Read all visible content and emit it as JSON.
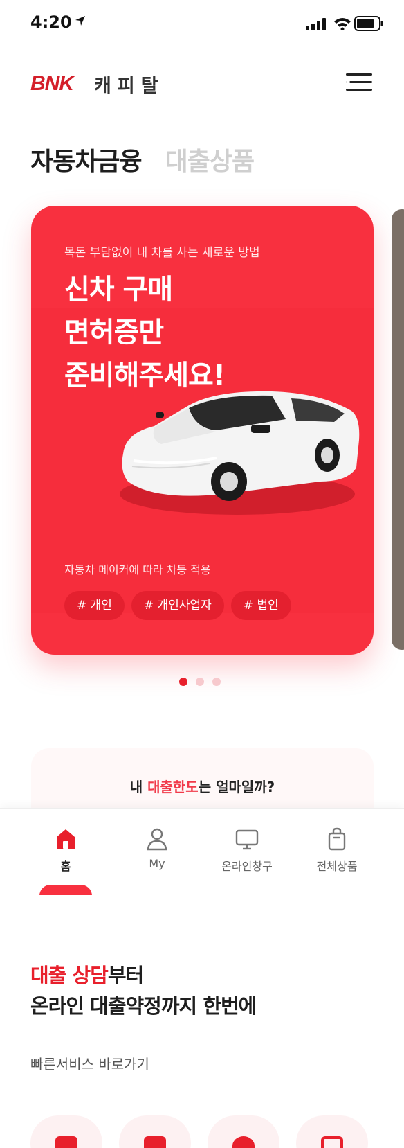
{
  "status_bar": {
    "time": "4:20"
  },
  "header": {
    "logo_brand": "BNK",
    "logo_sub": "캐피탈"
  },
  "tabs": [
    {
      "label": "자동차금융",
      "active": true
    },
    {
      "label": "대출상품",
      "active": false
    }
  ],
  "hero_card": {
    "eyebrow": "목돈 부담없이 내 차를 사는 새로운 방법",
    "title_lines": [
      "신차 구매",
      "면허증만",
      "준비해주세요!"
    ],
    "note": "자동차 메이커에 따라 차등 적용",
    "tags": [
      "# 개인",
      "# 개인사업자",
      "# 법인"
    ],
    "background_color": "#f8303f"
  },
  "carousel": {
    "total": 3,
    "current": 1
  },
  "limit_card": {
    "prefix": "내 ",
    "highlight": "대출한도",
    "suffix": "는 얼마일까?"
  },
  "tabbar": {
    "items": [
      {
        "label": "홈",
        "icon": "home-icon",
        "active": true
      },
      {
        "label": "My",
        "icon": "person-icon",
        "active": false
      },
      {
        "label": "온라인창구",
        "icon": "monitor-icon",
        "active": false
      },
      {
        "label": "전체상품",
        "icon": "bag-icon",
        "active": false
      }
    ]
  },
  "lower": {
    "title_highlight": "대출 상담",
    "title_rest_1": "부터",
    "title_line_2": "온라인 대출약정까지 한번에",
    "quick_label": "빠른서비스 바로가기"
  },
  "colors": {
    "accent": "#e8202c",
    "brand_red": "#d41f2a",
    "text_dark": "#1e1e1e",
    "inactive_tab": "#cfcfcf"
  }
}
